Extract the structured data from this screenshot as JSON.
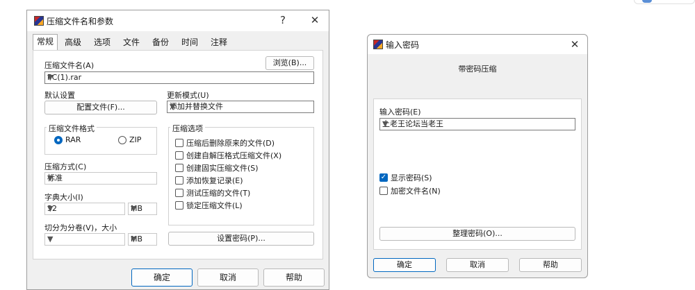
{
  "archive_dialog": {
    "title": "压缩文件名和参数",
    "help_glyph": "?",
    "close_glyph": "✕",
    "tabs": [
      "常规",
      "高级",
      "选项",
      "文件",
      "备份",
      "时间",
      "注释"
    ],
    "archive_name_label": "压缩文件名(A)",
    "browse_label": "浏览(B)...",
    "archive_name_value": "PC(1).rar",
    "default_settings_label": "默认设置",
    "profiles_label": "配置文件(F)...",
    "update_mode_label": "更新模式(U)",
    "update_mode_value": "添加并替换文件",
    "format_group_label": "压缩文件格式",
    "format_rar": "RAR",
    "format_zip": "ZIP",
    "options_group_label": "压缩选项",
    "options": [
      {
        "label": "压缩后删除原来的文件(D)",
        "checked": false
      },
      {
        "label": "创建自解压格式压缩文件(X)",
        "checked": false
      },
      {
        "label": "创建固实压缩文件(S)",
        "checked": false
      },
      {
        "label": "添加恢复记录(E)",
        "checked": false
      },
      {
        "label": "测试压缩的文件(T)",
        "checked": false
      },
      {
        "label": "锁定压缩文件(L)",
        "checked": false
      }
    ],
    "method_label": "压缩方式(C)",
    "method_value": "标准",
    "dict_label": "字典大小(I)",
    "dict_value": "32",
    "dict_unit": "MB",
    "split_label": "切分为分卷(V)，大小",
    "split_value": "",
    "split_unit": "MB",
    "set_password_label": "设置密码(P)...",
    "ok_label": "确定",
    "cancel_label": "取消",
    "help_label": "帮助"
  },
  "password_dialog": {
    "title": "输入密码",
    "close_glyph": "✕",
    "subtitle": "带密码压缩",
    "enter_password_label": "输入密码(E)",
    "password_value": "上老王论坛当老王",
    "show_password_label": "显示密码(S)",
    "show_password_checked": true,
    "encrypt_names_label": "加密文件名(N)",
    "encrypt_names_checked": false,
    "organize_label": "整理密码(O)...",
    "ok_label": "确定",
    "cancel_label": "取消",
    "help_label": "帮助"
  }
}
